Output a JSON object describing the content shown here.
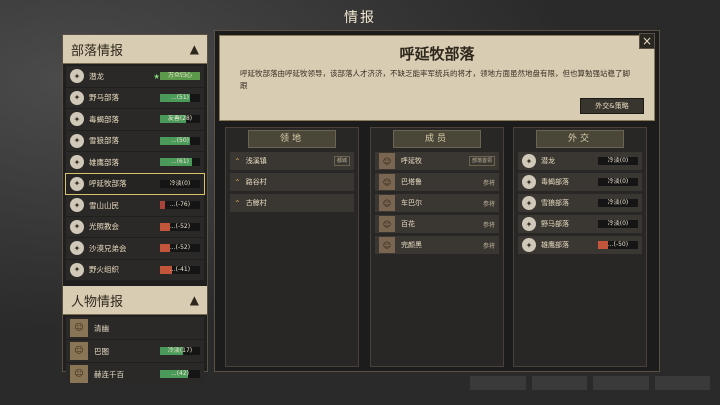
{
  "window": {
    "title": "情报"
  },
  "left_panel": {
    "tribes_header": "部落情报",
    "tribes": [
      {
        "name": "潜龙",
        "starred": true,
        "relation": "万众归心(100)",
        "level": 1.0,
        "color": "#5a9a4a"
      },
      {
        "name": "野马部落",
        "starred": false,
        "relation": "...(51)",
        "level": 0.75,
        "color": "#4a9a5a"
      },
      {
        "name": "毒蝎部落",
        "starred": false,
        "relation": "友善(28)",
        "level": 0.64,
        "color": "#4a9a5a"
      },
      {
        "name": "雪狼部落",
        "starred": false,
        "relation": "...(50)",
        "level": 0.75,
        "color": "#4a9a5a"
      },
      {
        "name": "雄鹰部落",
        "starred": false,
        "relation": "...(61)",
        "level": 0.8,
        "color": "#4a9a5a"
      },
      {
        "name": "呼延牧部落",
        "starred": false,
        "relation": "冷淡(0)",
        "level": 0.5,
        "color": "#151515"
      },
      {
        "name": "雪山山民",
        "starred": false,
        "relation": "...(-76)",
        "level": 0.12,
        "color": "#a8443a"
      },
      {
        "name": "光照教会",
        "starred": false,
        "relation": "...(-52)",
        "level": 0.24,
        "color": "#c2553a"
      },
      {
        "name": "沙漠兄弟会",
        "starred": false,
        "relation": "...(-52)",
        "level": 0.24,
        "color": "#c2553a"
      },
      {
        "name": "野火组织",
        "starred": false,
        "relation": "...(-41)",
        "level": 0.3,
        "color": "#c2553a"
      }
    ],
    "people_header": "人物情报",
    "people": [
      {
        "name": "清幽",
        "relation": "",
        "level": 0,
        "color": "#151515"
      },
      {
        "name": "巴图",
        "relation": "冷淡(17)",
        "level": 0.58,
        "color": "#4a9a5a"
      },
      {
        "name": "赫连千百",
        "relation": "...(42)",
        "level": 0.7,
        "color": "#4a9a5a"
      }
    ],
    "selected_index": 5
  },
  "main": {
    "title": "呼延牧部落",
    "description": "呼延牧部落由呼延牧领导，该部落人才济济，不缺乏能率军统兵的将才，领地方面虽然地盘有限，但也算勉强站稳了脚跟",
    "strategy_button": "外交&策略",
    "close": "×",
    "territory": {
      "header": "领地",
      "items": [
        {
          "name": "浅溪镇",
          "tag": "都城"
        },
        {
          "name": "路谷村",
          "tag": ""
        },
        {
          "name": "古鲸村",
          "tag": ""
        }
      ]
    },
    "members": {
      "header": "成员",
      "items": [
        {
          "name": "呼延牧",
          "role": "部落首领"
        },
        {
          "name": "巴塔鲁",
          "role": "参将"
        },
        {
          "name": "车巴尔",
          "role": "参将"
        },
        {
          "name": "百花",
          "role": "参将"
        },
        {
          "name": "完颜黑",
          "role": "参将"
        }
      ]
    },
    "diplomacy": {
      "header": "外交",
      "items": [
        {
          "name": "潜龙",
          "relation": "冷淡(0)",
          "level": 0.5,
          "color": "#151515"
        },
        {
          "name": "毒蝎部落",
          "relation": "冷淡(0)",
          "level": 0.5,
          "color": "#151515"
        },
        {
          "name": "雪狼部落",
          "relation": "冷淡(0)",
          "level": 0.5,
          "color": "#151515"
        },
        {
          "name": "野马部落",
          "relation": "冷淡(0)",
          "level": 0.5,
          "color": "#151515"
        },
        {
          "name": "雄鹰部落",
          "relation": "...(-50)",
          "level": 0.25,
          "color": "#c2553a"
        }
      ]
    }
  }
}
